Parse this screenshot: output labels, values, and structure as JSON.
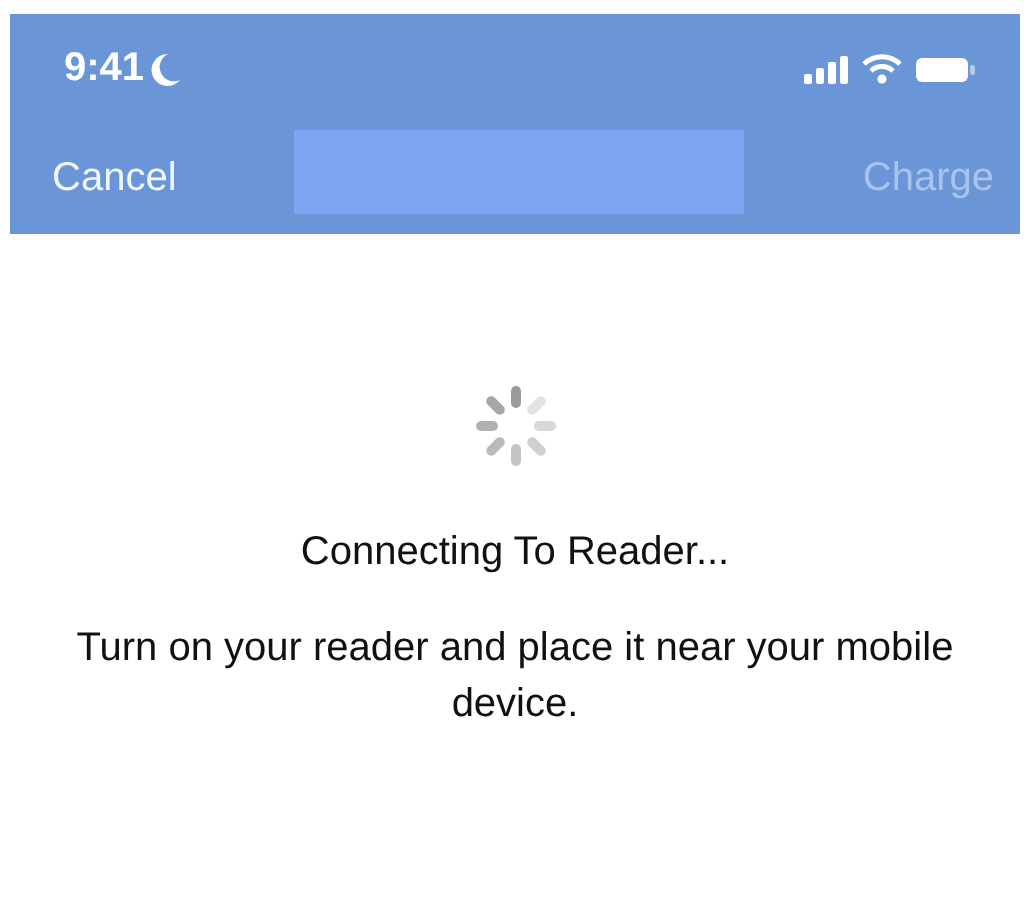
{
  "status_bar": {
    "time": "9:41"
  },
  "nav_bar": {
    "left_button": {
      "label": "Cancel",
      "disabled": false
    },
    "right_button": {
      "label": "Charge",
      "disabled": true
    }
  },
  "content": {
    "title": "Connecting To Reader...",
    "message": "Turn on your reader and place it near your mobile device."
  }
}
